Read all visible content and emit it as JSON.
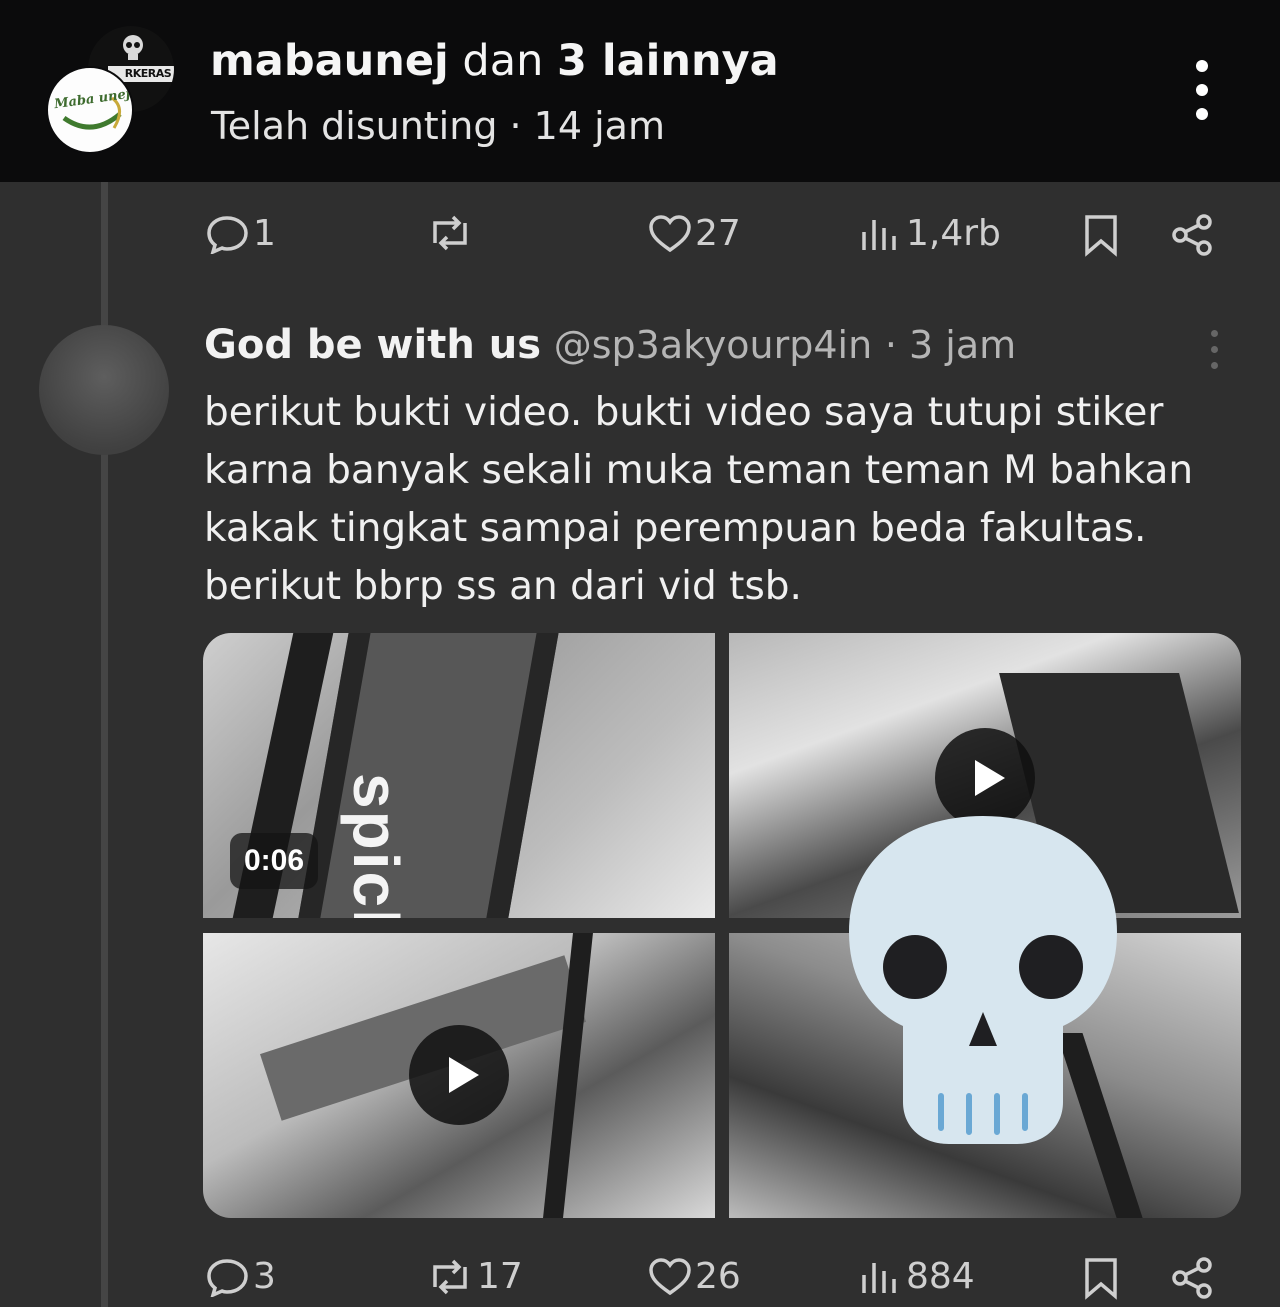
{
  "header": {
    "users": "mabaunej",
    "joiner": "dan",
    "others": "3 lainnya",
    "subtitle": "Telah disunting · 14 jam",
    "avatar_back_text": "RKERAS",
    "avatar_front_text": "Maba unej"
  },
  "post_actions": {
    "replies": "1",
    "reposts": "",
    "likes": "27",
    "views": "1,4rb"
  },
  "reply": {
    "name": "God be with us",
    "handle": "@sp3akyourp4in",
    "time": "· 3 jam",
    "text": "berikut bukti video. bukti video saya tutupi stiker karna banyak sekali muka teman teman M bahkan kakak tingkat sampai perempuan beda fakultas. berikut bbrp ss an dari vid tsb.",
    "media": {
      "duration": "0:06",
      "tile1_text": "spicle"
    },
    "actions": {
      "replies": "3",
      "reposts": "17",
      "likes": "26",
      "views": "884"
    }
  },
  "colors": {
    "background": "#2f2f2f",
    "header_bg": "#0b0b0c",
    "text": "#e9e9e9",
    "muted": "#b5b5b5"
  }
}
